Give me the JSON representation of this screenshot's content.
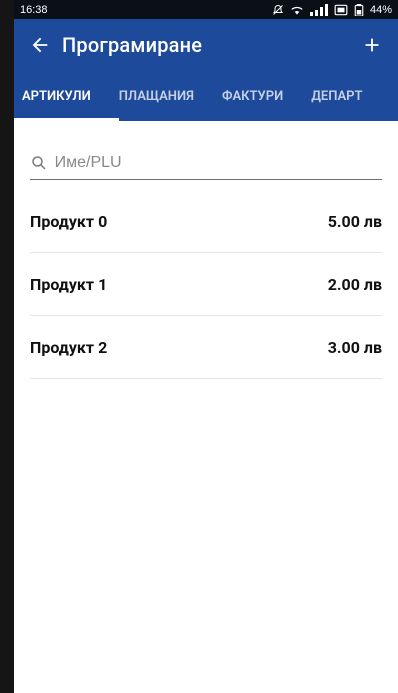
{
  "status": {
    "time": "16:38",
    "icons": [
      "silent-icon",
      "wifi-icon",
      "signal-icon",
      "sim-icon",
      "battery-icon"
    ],
    "battery": "44%"
  },
  "header": {
    "title": "Програмиране",
    "back_icon": "back-arrow-icon",
    "add_icon": "plus-icon"
  },
  "tabs": [
    {
      "label": "АРТИКУЛИ",
      "active": true
    },
    {
      "label": "ПЛАЩАНИЯ"
    },
    {
      "label": "ФАКТУРИ"
    },
    {
      "label": "ДЕПАРТ"
    }
  ],
  "search": {
    "placeholder": "Име/PLU"
  },
  "items": [
    {
      "name": "Продукт 0",
      "price": "5.00 лв"
    },
    {
      "name": "Продукт 1",
      "price": "2.00 лв"
    },
    {
      "name": "Продукт 2",
      "price": "3.00 лв"
    }
  ],
  "colors": {
    "primary": "#1e4a9b",
    "status_bar": "#0b0f16"
  }
}
